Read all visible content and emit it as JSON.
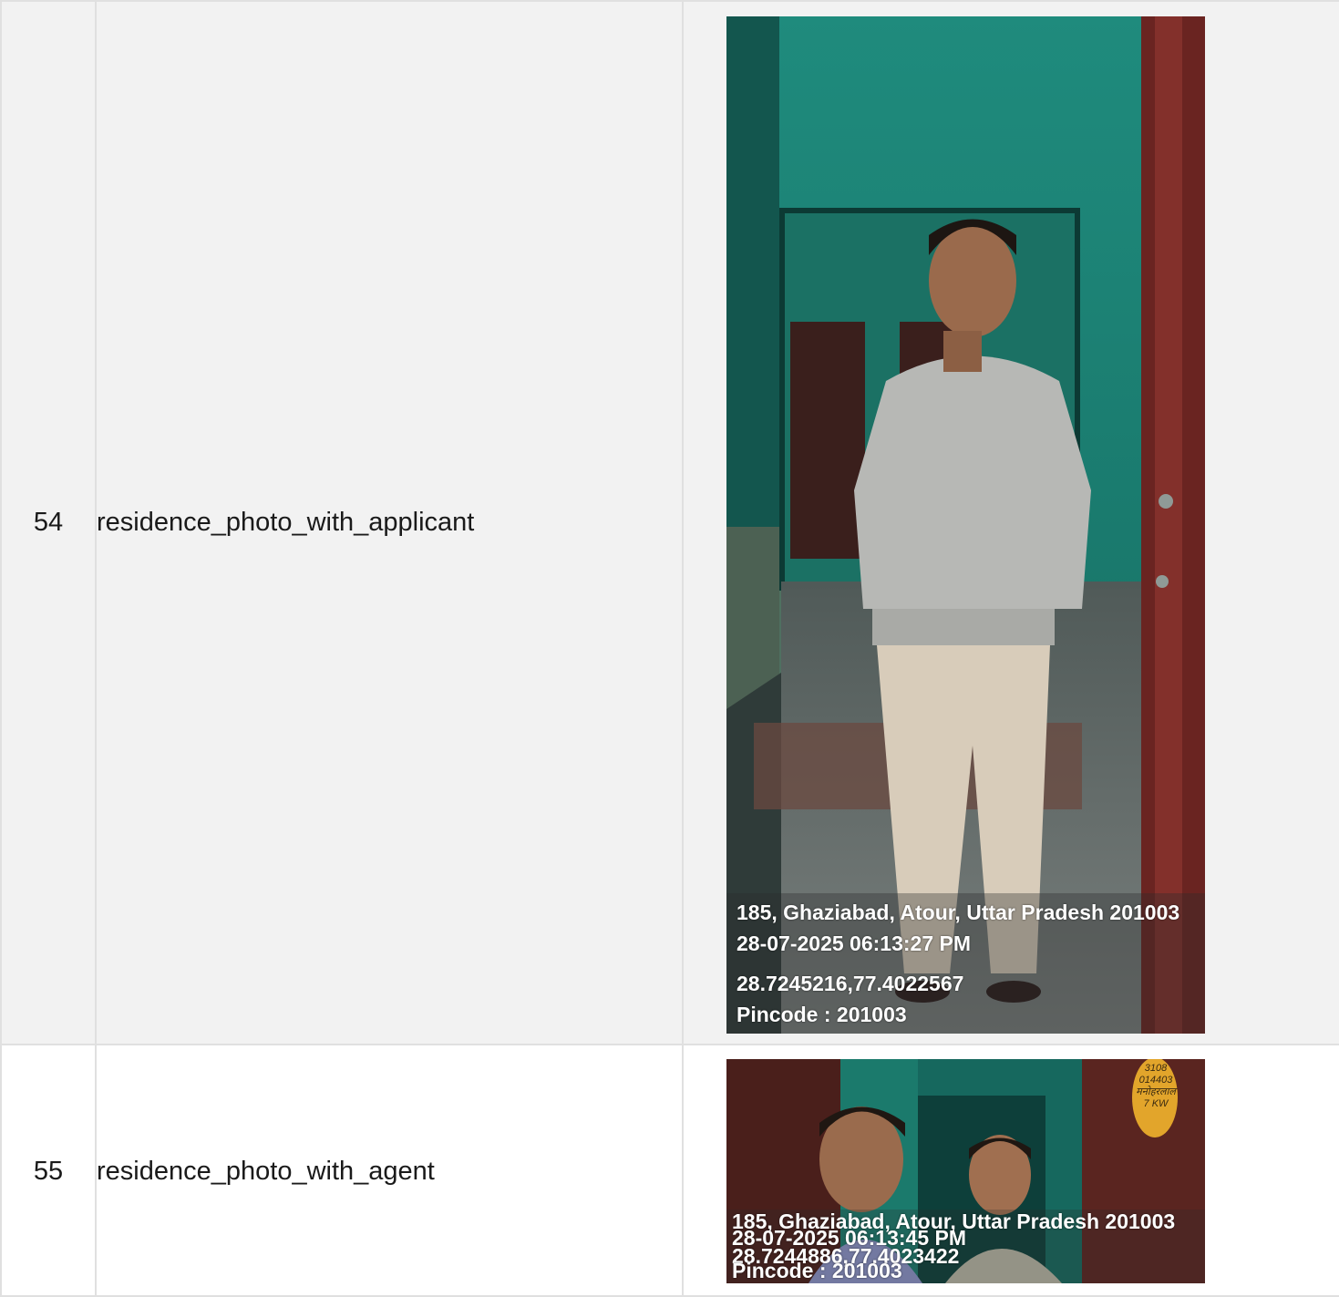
{
  "rows": [
    {
      "number": "54",
      "label": "residence_photo_with_applicant",
      "photo": {
        "address": "185, Ghaziabad, Atour, Uttar Pradesh 201003",
        "timestamp": "28-07-2025 06:13:27 PM",
        "coords": "28.7245216,77.4022567",
        "pincode": "Pincode : 201003"
      }
    },
    {
      "number": "55",
      "label": "residence_photo_with_agent",
      "photo": {
        "address": "185, Ghaziabad, Atour, Uttar Pradesh 201003",
        "timestamp": "28-07-2025 06:13:45 PM",
        "coords": "28.7244886,77.4023422",
        "pincode": "Pincode : 201003",
        "meter_tag": [
          "3108",
          "014403",
          "मनोहरलाल",
          "7 KW"
        ]
      }
    }
  ]
}
